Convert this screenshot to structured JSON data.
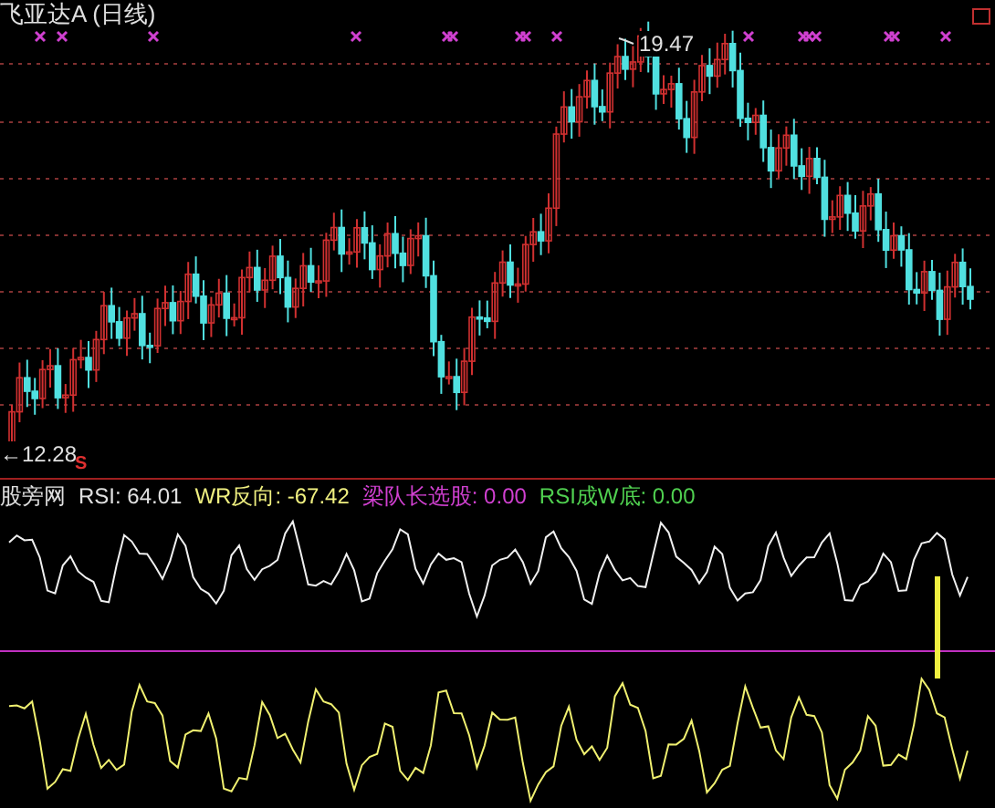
{
  "chart": {
    "title": "飞亚达A (日线)",
    "high_label": "19.47",
    "low_label": "←12.28",
    "signal_label": "S"
  },
  "indicator_bar": {
    "name": "股旁网",
    "items": [
      {
        "text": "RSI: 64.01",
        "color": "#e0e0e0"
      },
      {
        "text": "WR反向: -67.42",
        "color": "#f0f080"
      },
      {
        "text": "梁队长选股: 0.00",
        "color": "#d040d0"
      },
      {
        "text": "RSI成W底: 0.00",
        "color": "#50d050"
      }
    ]
  }
}
